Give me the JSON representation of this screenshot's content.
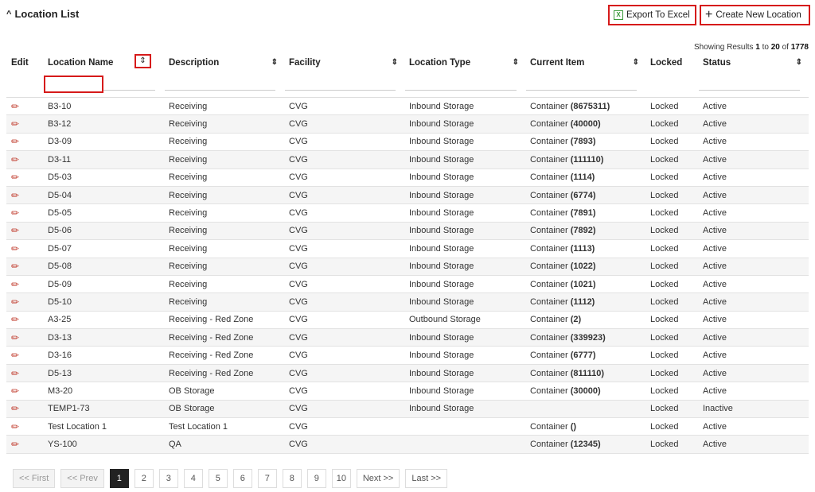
{
  "header": {
    "title": "Location List",
    "chevron": "chevron-up-icon"
  },
  "toolbar": {
    "export_label": "Export To Excel",
    "create_label": "Create New Location"
  },
  "showing": {
    "prefix": "Showing Results ",
    "from": "1",
    "to_word": " to ",
    "to": "20",
    "of_word": " of ",
    "total": "1778"
  },
  "columns": [
    "Edit",
    "Location Name",
    "Description",
    "Facility",
    "Location Type",
    "Current Item",
    "Locked",
    "Status"
  ],
  "rows": [
    {
      "name": "B3-10",
      "desc": "Receiving",
      "facility": "CVG",
      "type": "Inbound Storage",
      "item": "Container ",
      "item_id": "(8675311)",
      "locked": "Locked",
      "status": "Active"
    },
    {
      "name": "B3-12",
      "desc": "Receiving",
      "facility": "CVG",
      "type": "Inbound Storage",
      "item": "Container ",
      "item_id": "(40000)",
      "locked": "Locked",
      "status": "Active"
    },
    {
      "name": "D3-09",
      "desc": "Receiving",
      "facility": "CVG",
      "type": "Inbound Storage",
      "item": "Container ",
      "item_id": "(7893)",
      "locked": "Locked",
      "status": "Active"
    },
    {
      "name": "D3-11",
      "desc": "Receiving",
      "facility": "CVG",
      "type": "Inbound Storage",
      "item": "Container ",
      "item_id": "(111110)",
      "locked": "Locked",
      "status": "Active"
    },
    {
      "name": "D5-03",
      "desc": "Receiving",
      "facility": "CVG",
      "type": "Inbound Storage",
      "item": "Container ",
      "item_id": "(1114)",
      "locked": "Locked",
      "status": "Active"
    },
    {
      "name": "D5-04",
      "desc": "Receiving",
      "facility": "CVG",
      "type": "Inbound Storage",
      "item": "Container ",
      "item_id": "(6774)",
      "locked": "Locked",
      "status": "Active"
    },
    {
      "name": "D5-05",
      "desc": "Receiving",
      "facility": "CVG",
      "type": "Inbound Storage",
      "item": "Container ",
      "item_id": "(7891)",
      "locked": "Locked",
      "status": "Active"
    },
    {
      "name": "D5-06",
      "desc": "Receiving",
      "facility": "CVG",
      "type": "Inbound Storage",
      "item": "Container ",
      "item_id": "(7892)",
      "locked": "Locked",
      "status": "Active"
    },
    {
      "name": "D5-07",
      "desc": "Receiving",
      "facility": "CVG",
      "type": "Inbound Storage",
      "item": "Container ",
      "item_id": "(1113)",
      "locked": "Locked",
      "status": "Active"
    },
    {
      "name": "D5-08",
      "desc": "Receiving",
      "facility": "CVG",
      "type": "Inbound Storage",
      "item": "Container ",
      "item_id": "(1022)",
      "locked": "Locked",
      "status": "Active"
    },
    {
      "name": "D5-09",
      "desc": "Receiving",
      "facility": "CVG",
      "type": "Inbound Storage",
      "item": "Container ",
      "item_id": "(1021)",
      "locked": "Locked",
      "status": "Active"
    },
    {
      "name": "D5-10",
      "desc": "Receiving",
      "facility": "CVG",
      "type": "Inbound Storage",
      "item": "Container ",
      "item_id": "(1112)",
      "locked": "Locked",
      "status": "Active"
    },
    {
      "name": "A3-25",
      "desc": "Receiving - Red Zone",
      "facility": "CVG",
      "type": "Outbound Storage",
      "item": "Container ",
      "item_id": "(2)",
      "locked": "Locked",
      "status": "Active"
    },
    {
      "name": "D3-13",
      "desc": "Receiving - Red Zone",
      "facility": "CVG",
      "type": "Inbound Storage",
      "item": "Container ",
      "item_id": "(339923)",
      "locked": "Locked",
      "status": "Active"
    },
    {
      "name": "D3-16",
      "desc": "Receiving - Red Zone",
      "facility": "CVG",
      "type": "Inbound Storage",
      "item": "Container ",
      "item_id": "(6777)",
      "locked": "Locked",
      "status": "Active"
    },
    {
      "name": "D5-13",
      "desc": "Receiving - Red Zone",
      "facility": "CVG",
      "type": "Inbound Storage",
      "item": "Container ",
      "item_id": "(811110)",
      "locked": "Locked",
      "status": "Active"
    },
    {
      "name": "M3-20",
      "desc": "OB Storage",
      "facility": "CVG",
      "type": "Inbound Storage",
      "item": "Container ",
      "item_id": "(30000)",
      "locked": "Locked",
      "status": "Active"
    },
    {
      "name": "TEMP1-73",
      "desc": "OB Storage",
      "facility": "CVG",
      "type": "Inbound Storage",
      "item": "",
      "item_id": "",
      "locked": "Locked",
      "status": "Inactive"
    },
    {
      "name": "Test Location 1",
      "desc": "Test Location 1",
      "facility": "CVG",
      "type": "",
      "item": "Container ",
      "item_id": "()",
      "locked": "Locked",
      "status": "Active"
    },
    {
      "name": "YS-100",
      "desc": "QA",
      "facility": "CVG",
      "type": "",
      "item": "Container ",
      "item_id": "(12345)",
      "locked": "Locked",
      "status": "Active"
    }
  ],
  "pagination": {
    "first": "<< First",
    "prev": "<< Prev",
    "next": "Next >>",
    "last": "Last >>",
    "pages": [
      "1",
      "2",
      "3",
      "4",
      "5",
      "6",
      "7",
      "8",
      "9",
      "10"
    ],
    "current": "1"
  },
  "colors": {
    "highlight": "#d61a1a",
    "edit_icon": "#c0392b",
    "excel_icon": "#3a9a3a"
  }
}
